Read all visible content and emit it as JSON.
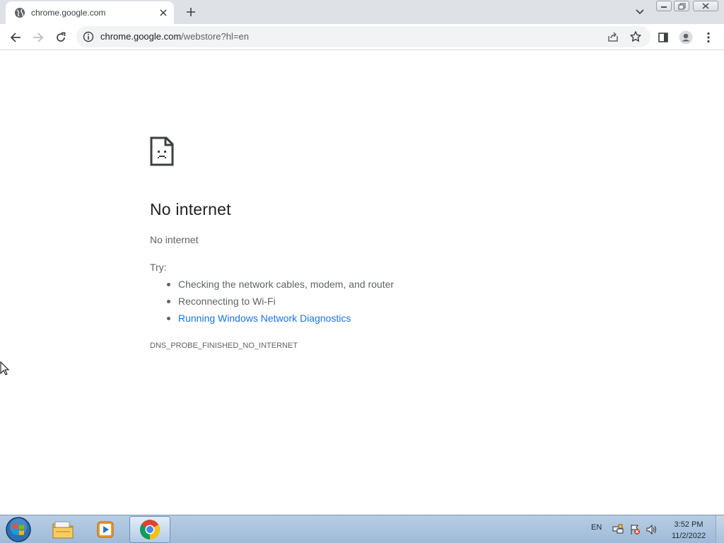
{
  "browser": {
    "tab": {
      "title": "chrome.google.com",
      "favicon": "globe-icon",
      "close_icon": "close-icon"
    },
    "new_tab_icon": "plus-icon",
    "tab_search_icon": "chevron-down-icon",
    "window_controls": [
      "minimize-icon",
      "restore-icon",
      "close-icon"
    ],
    "toolbar": {
      "back_icon": "arrow-left-icon",
      "forward_icon": "arrow-right-icon",
      "reload_icon": "reload-icon",
      "url_host": "chrome.google.com",
      "url_rest": "/webstore?hl=en",
      "site_info_icon": "info-icon",
      "share_icon": "share-icon",
      "bookmark_icon": "star-icon",
      "side_panel_icon": "side-panel-icon",
      "profile_icon": "profile-icon",
      "menu_icon": "kebab-menu-icon"
    }
  },
  "error_page": {
    "icon": "sad-document-icon",
    "heading": "No internet",
    "subheading": "No internet",
    "try_label": "Try:",
    "suggestions": [
      {
        "text": "Checking the network cables, modem, and router",
        "link": false
      },
      {
        "text": "Reconnecting to Wi-Fi",
        "link": false
      },
      {
        "text": "Running Windows Network Diagnostics",
        "link": true
      }
    ],
    "error_code": "DNS_PROBE_FINISHED_NO_INTERNET"
  },
  "taskbar": {
    "start_icon": "windows-start-icon",
    "pinned": [
      "file-explorer-icon",
      "media-player-icon",
      "chrome-icon"
    ],
    "language": "EN",
    "tray_icons": [
      "network-icon",
      "action-center-icon",
      "volume-icon"
    ],
    "time": "3:52 PM",
    "date": "11/2/2022"
  },
  "colors": {
    "accent_link": "#1a73e8",
    "text_primary": "#202124",
    "text_secondary": "#5f6368",
    "tabstrip": "#dee1e6"
  }
}
